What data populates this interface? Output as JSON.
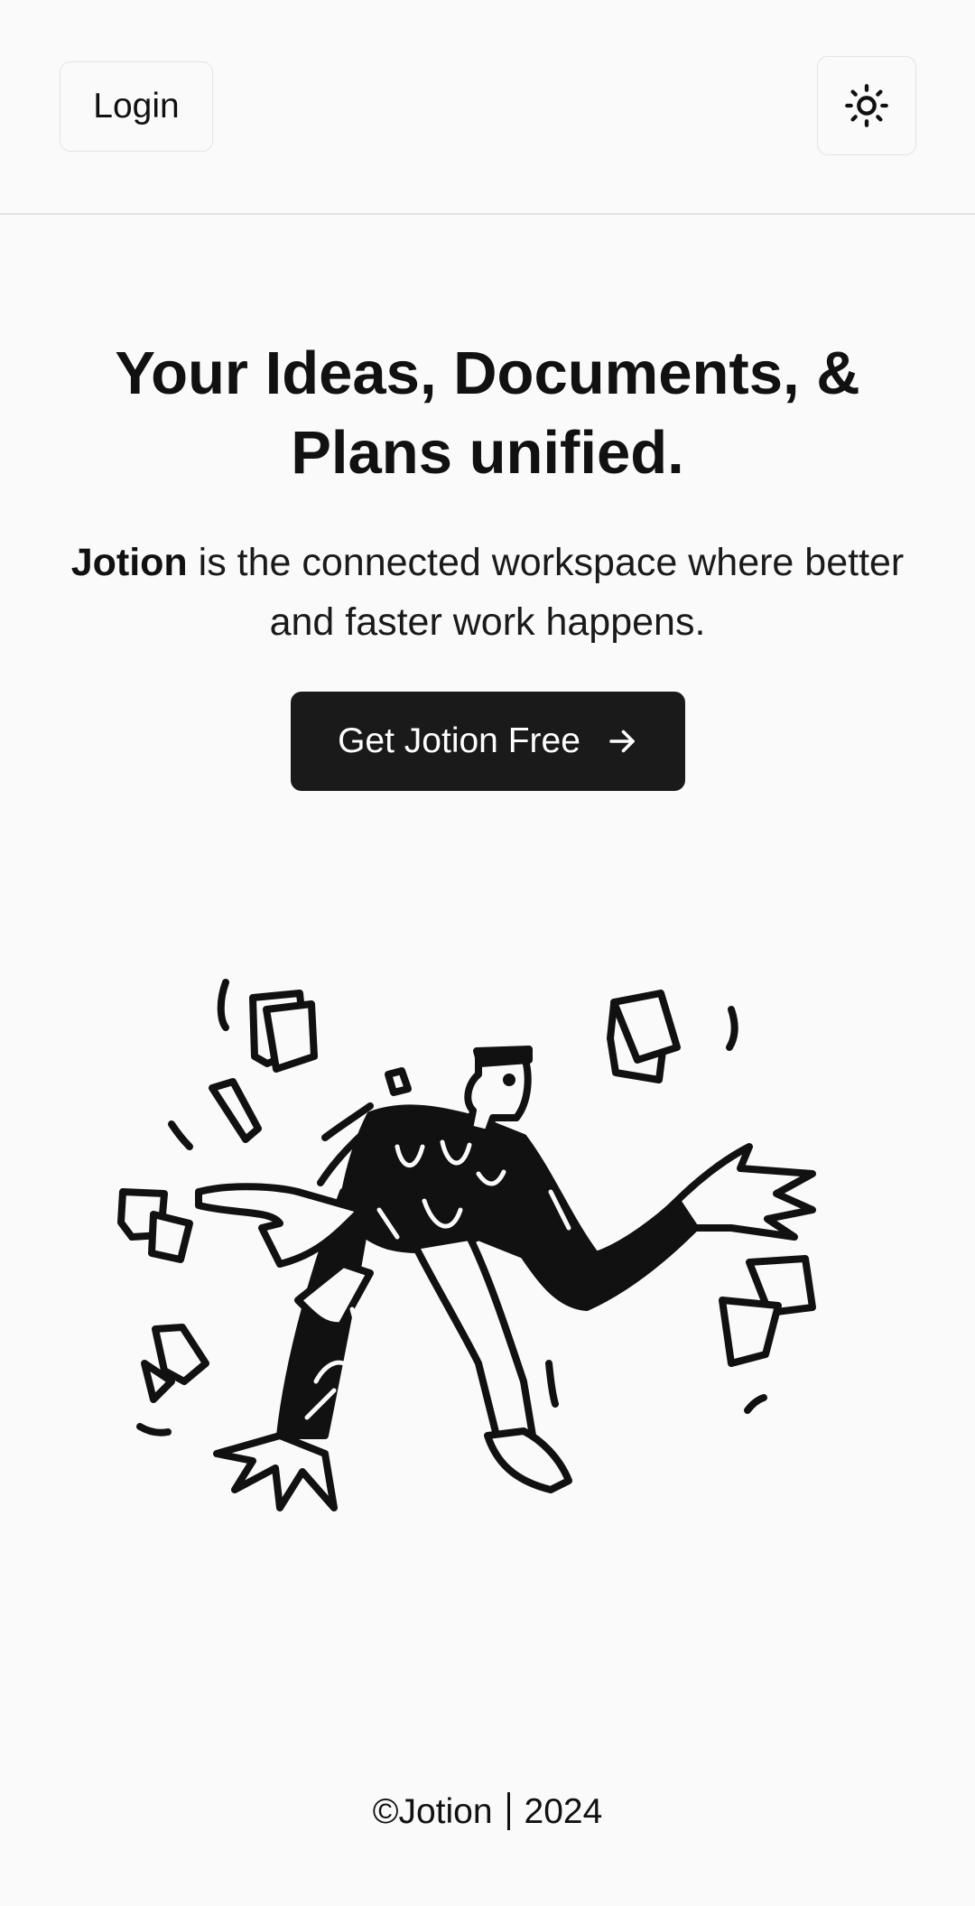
{
  "header": {
    "login_label": "Login",
    "theme_toggle_icon": "sun-icon"
  },
  "hero": {
    "title": "Your Ideas, Documents, & Plans unified.",
    "subtitle_brand": "Jotion",
    "subtitle_rest": " is the connected workspace where better and faster work happens.",
    "cta_label": "Get Jotion Free",
    "cta_icon": "arrow-right-icon"
  },
  "illustration": {
    "icon": "person-juggling-documents-illustration"
  },
  "footer": {
    "brand": "©Jotion",
    "year": "2024"
  },
  "colors": {
    "background": "#fafafa",
    "text": "#111111",
    "button_dark": "#1a1a1a",
    "border": "#e3e3e3"
  }
}
